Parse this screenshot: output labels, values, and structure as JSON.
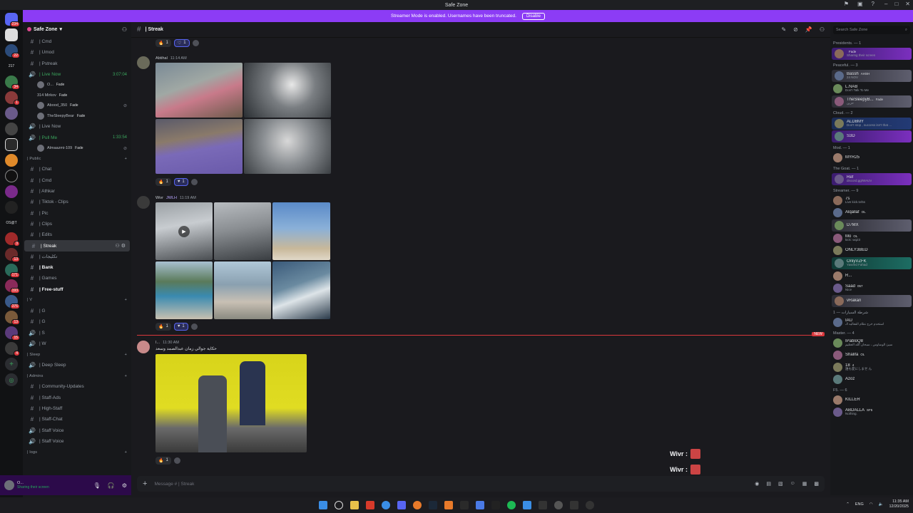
{
  "window": {
    "title": "Safe Zone"
  },
  "banner": {
    "text": "Streamer Mode is enabled. Usernames have been truncated.",
    "button": "Disable"
  },
  "server_rail": {
    "badges": [
      "234",
      "22",
      "34",
      "1",
      "3",
      "13",
      "171",
      "193",
      "376",
      "13",
      "15",
      "4"
    ],
    "labels": [
      "217",
      "OS@T"
    ]
  },
  "guild": {
    "name": "Safe Zone"
  },
  "channels_top": [
    {
      "icon": "#",
      "label": "| Cmd"
    },
    {
      "icon": "#",
      "label": "| Umod"
    },
    {
      "icon": "#",
      "label": "| Pstreak"
    }
  ],
  "live_now_1": {
    "label": "| Live Now",
    "time": "3:07:04"
  },
  "live_now_1_users": [
    {
      "name": "O...",
      "tag": "Fade"
    },
    {
      "name": "314 Mirkov",
      "tag": "Fade"
    },
    {
      "name": "Abood_350",
      "tag": "Fade"
    },
    {
      "name": "TheSleepyBear",
      "tag": "Fade"
    }
  ],
  "live_now_2": {
    "label": "| Live Now"
  },
  "pull_me": {
    "label": "| Pull Me",
    "time": "1:33:54"
  },
  "pull_me_users": [
    {
      "name": "Almaazmi-109",
      "tag": "Fade"
    }
  ],
  "cat_public": "| Public",
  "channels_public": [
    {
      "label": "| Chat"
    },
    {
      "label": "| Cmd"
    },
    {
      "label": "| Athkar"
    },
    {
      "label": "| Tiktok - Clips"
    },
    {
      "label": "| Pic"
    },
    {
      "label": "| Clips"
    },
    {
      "label": "| Edits"
    }
  ],
  "active_channel": "| Streak",
  "channels_public2": [
    {
      "label": "| تكليجات",
      "bold": false
    },
    {
      "label": "| Bank",
      "bold": true
    },
    {
      "label": "| Games",
      "bold": false
    },
    {
      "label": "| Free-stuff",
      "bold": true
    }
  ],
  "cat_v": "| V",
  "channels_v": [
    {
      "label": "| G"
    },
    {
      "label": "| G"
    },
    {
      "label": "| S"
    },
    {
      "label": "| W"
    }
  ],
  "cat_sleep": "| Sleep",
  "channels_sleep": [
    {
      "label": "| Deep Sleep"
    }
  ],
  "cat_admins": "| Admins",
  "channels_admins": [
    {
      "label": "| Community-Updates"
    },
    {
      "label": "| Staff-Ads"
    },
    {
      "label": "| High-Staff"
    },
    {
      "label": "| Staff-Chat"
    },
    {
      "label": "| Staff Voice"
    },
    {
      "label": "| Staff Voice"
    }
  ],
  "cat_logs": "| logs",
  "user_panel": {
    "name": "O...",
    "status": "Sharing their screen"
  },
  "chat": {
    "channel": "| Streak",
    "top_reactions": [
      {
        "count": "1"
      },
      {
        "count": "1"
      }
    ],
    "msg1": {
      "author": "Abtihal",
      "time": "11:14 AM",
      "reactions": [
        {
          "count": "1"
        },
        {
          "count": "1"
        }
      ]
    },
    "msg2": {
      "author": "Wivr",
      "badge": "JWLH",
      "time": "11:19 AM",
      "reactions": [
        {
          "count": "1"
        },
        {
          "count": "1"
        }
      ]
    },
    "msg3": {
      "author": "I...",
      "time": "11:30 AM",
      "text": "حكاية جوالي زمان عبدالصمد وسعد",
      "reactions": [
        {
          "count": "1"
        }
      ]
    },
    "new_label": "NEW",
    "floating": [
      {
        "text": "Wivr :"
      },
      {
        "text": "Wivr :"
      }
    ],
    "composer_placeholder": "Message #  | Streak"
  },
  "members": {
    "search_placeholder": "Search Safe Zone",
    "groups": [
      {
        "title": "Presidents. — 1",
        "items": [
          {
            "name": "",
            "status": "Sharing their screen",
            "tag": "Fade",
            "hl": "hl"
          }
        ]
      },
      {
        "title": "Peaceful. — 3",
        "items": [
          {
            "name": "Bassh",
            "status": "24 NOV",
            "tag": "AHSH",
            "hl": "hl3"
          },
          {
            "name": "L.NAB",
            "status": "Don't Talk To Me",
            "tag": "",
            "hl": ""
          },
          {
            "name": "TheSleepyB...",
            "status": "حزين",
            "tag": "Fade",
            "hl": "hl3"
          }
        ]
      },
      {
        "title": "Cloud. — 2",
        "items": [
          {
            "name": "ALD8MY",
            "status": "Don't stop , success isn't that ...",
            "tag": "",
            "hl": "hl2"
          },
          {
            "name": "S3D",
            "status": "",
            "tag": "",
            "hl": "hl"
          }
        ]
      },
      {
        "title": "Mod. — 1",
        "items": [
          {
            "name": "MYR25",
            "status": "",
            "tag": "",
            "hl": ""
          }
        ]
      },
      {
        "title": "The Goat. — 1",
        "items": [
          {
            "name": "Ref",
            "status": "discord.gg/WAUV",
            "tag": "",
            "hl": "hl"
          }
        ]
      },
      {
        "title": "Streamer. — 9",
        "items": [
          {
            "name": "7s",
            "status": "Live kick.tv/5s",
            "tag": "",
            "hl": ""
          },
          {
            "name": "Alqallaf",
            "status": "",
            "tag": "OL",
            "hl": ""
          },
          {
            "name": "D7MX",
            "status": "",
            "tag": "",
            "hl": "hl3"
          },
          {
            "name": "Mo",
            "status": "kick: wq23",
            "tag": "OL",
            "hl": ""
          },
          {
            "name": "ONLY3BED",
            "status": "",
            "tag": "",
            "hl": ""
          },
          {
            "name": "OnlyVZFK",
            "status": "Yaseed Fahad",
            "tag": "",
            "hl": "hl4"
          },
          {
            "name": "R...",
            "status": "",
            "tag": "",
            "hl": ""
          },
          {
            "name": "Saad",
            "status": "Nice",
            "tag": "057",
            "hl": ""
          },
          {
            "name": "vRakan",
            "status": "",
            "tag": "",
            "hl": "hl3"
          }
        ]
      },
      {
        "title": "شرطة السيارات — 1",
        "items": [
          {
            "name": "IAU",
            "status": "استخدم خرج نظام الفعاليه الـ",
            "tag": "",
            "hl": ""
          }
        ]
      },
      {
        "title": "Master. — 4",
        "items": [
          {
            "name": "IPabloQ8",
            "status": "سيئ الوساوس ، سبحان الله العظيم",
            "tag": "",
            "hl": ""
          },
          {
            "name": "Shalifa",
            "status": "",
            "tag": "OL",
            "hl": ""
          },
          {
            "name": "18",
            "status": "誰も愛にしませ ん",
            "tag": "4",
            "hl": ""
          },
          {
            "name": "Azoz",
            "status": "",
            "tag": "",
            "hl": ""
          }
        ]
      },
      {
        "title": "F5. — 6",
        "items": [
          {
            "name": "KILLER",
            "status": "",
            "tag": "",
            "hl": ""
          },
          {
            "name": "ABDALLA",
            "status": "Nothing.",
            "tag": "SF5",
            "hl": ""
          }
        ]
      }
    ]
  },
  "tray": {
    "lang": "ENG",
    "time": "11:35 AM",
    "date": "12/20/2025"
  }
}
